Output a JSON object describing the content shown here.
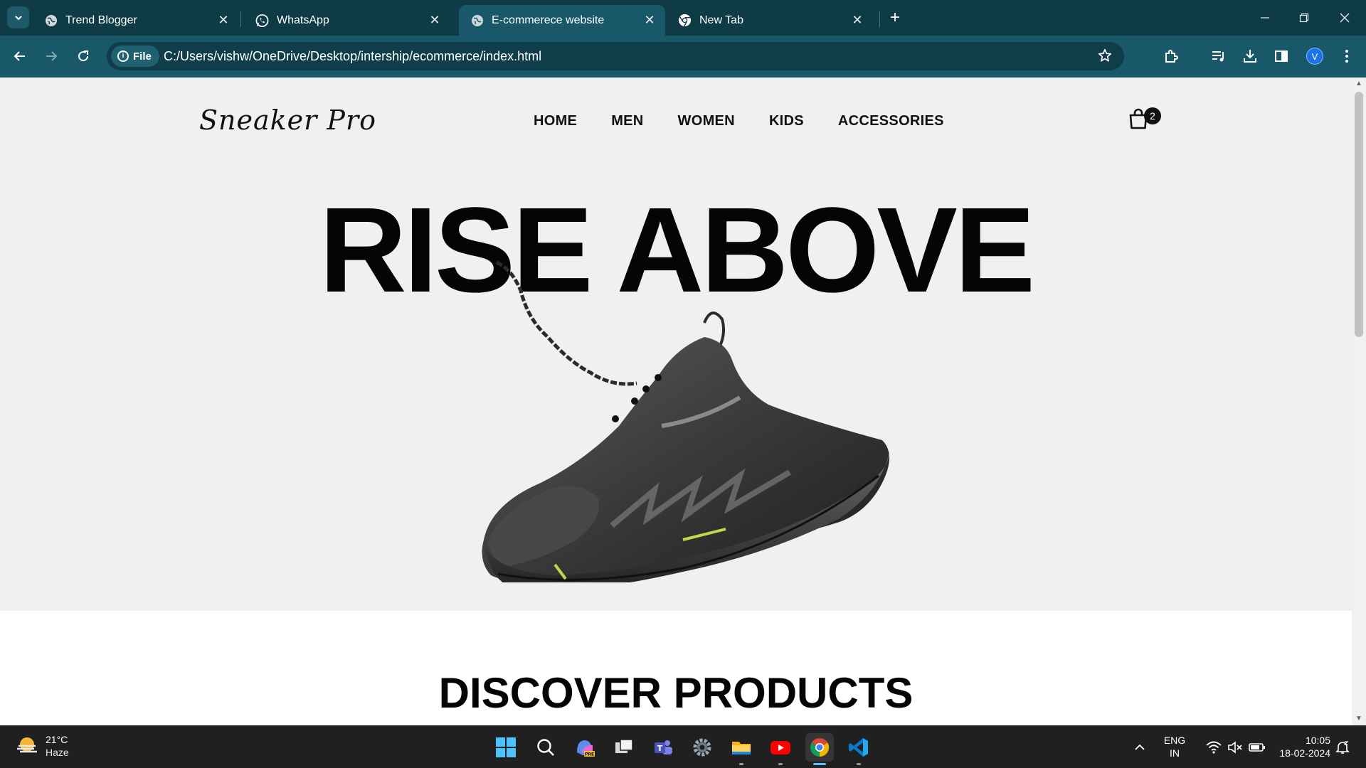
{
  "browser": {
    "tabs": [
      {
        "title": "Trend Blogger",
        "active": false
      },
      {
        "title": "WhatsApp",
        "active": false
      },
      {
        "title": "E-commerece website",
        "active": true
      },
      {
        "title": "New Tab",
        "active": false
      }
    ],
    "address": {
      "scheme_chip": "File",
      "url": "C:/Users/vishw/OneDrive/Desktop/intership/ecommerce/index.html"
    },
    "profile_initial": "V"
  },
  "site": {
    "logo": "Sneaker Pro",
    "nav": [
      "HOME",
      "MEN",
      "WOMEN",
      "KIDS",
      "ACCESSORIES"
    ],
    "cart_count": "2",
    "hero_headline": "RISE ABOVE",
    "section_title": "DISCOVER PRODUCTS"
  },
  "taskbar": {
    "weather": {
      "temp": "21°C",
      "condition": "Haze"
    },
    "language": {
      "line1": "ENG",
      "line2": "IN"
    },
    "clock": {
      "time": "10:05",
      "date": "18-02-2024"
    }
  },
  "colors": {
    "tabbar": "#0f3b47",
    "toolbar": "#185868",
    "hero_bg": "#f1eff0",
    "taskbar": "#202020"
  }
}
